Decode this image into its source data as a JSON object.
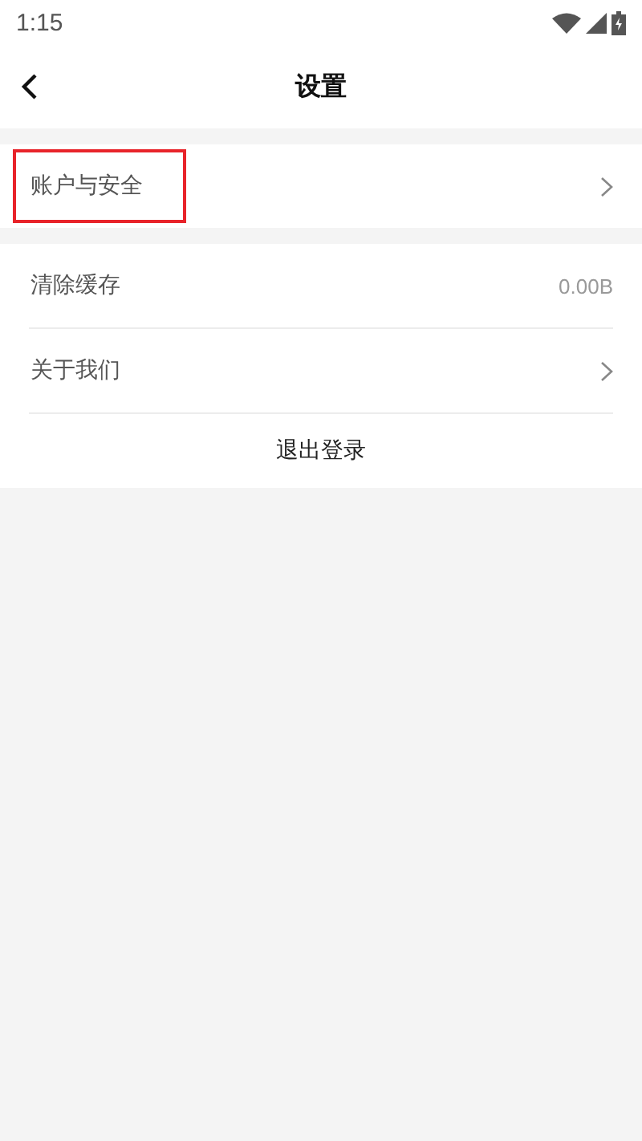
{
  "status_bar": {
    "time": "1:15"
  },
  "header": {
    "title": "设置"
  },
  "groups": [
    {
      "items": [
        {
          "kind": "link",
          "label": "账户与安全",
          "highlighted": true
        }
      ]
    },
    {
      "items": [
        {
          "kind": "value",
          "label": "清除缓存",
          "value": "0.00B",
          "highlighted": false
        },
        {
          "kind": "link",
          "label": "关于我们",
          "highlighted": false
        },
        {
          "kind": "action",
          "label": "退出登录",
          "highlighted": false
        }
      ]
    }
  ]
}
